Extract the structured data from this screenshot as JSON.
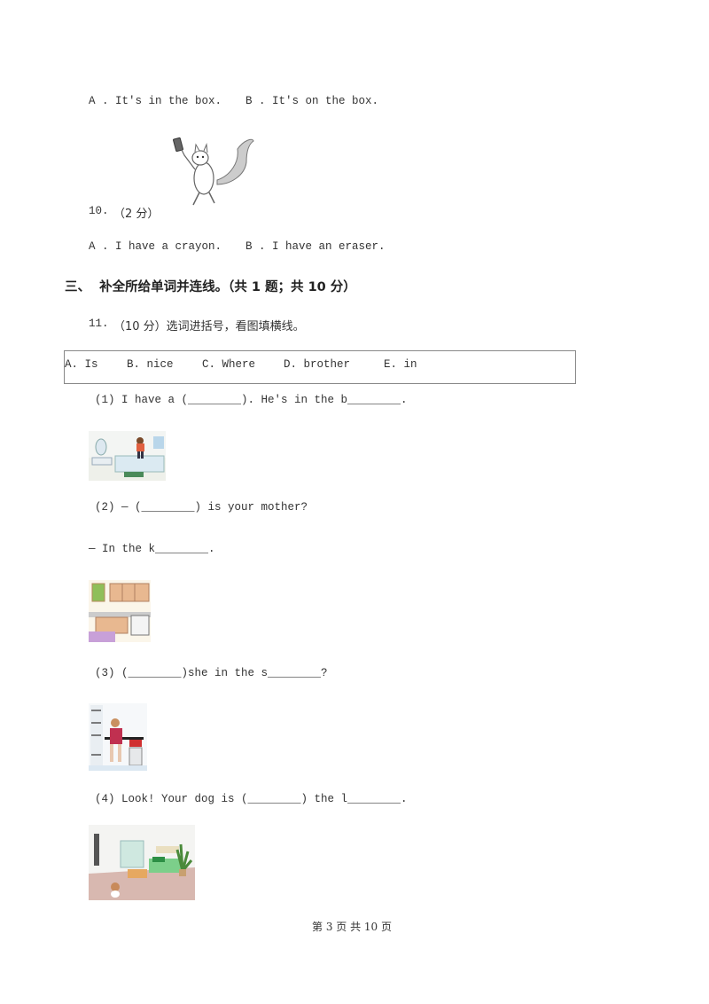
{
  "q9": {
    "option_a": "A . It's in the box.",
    "option_b": "B . It's on the box."
  },
  "q10": {
    "number": "10.",
    "score": "（2 分）",
    "image": "squirrel-holding-eraser",
    "option_a": "A . I have a crayon.",
    "option_b": "B . I have an eraser."
  },
  "section3": {
    "title": "三、  补全所给单词并连线。（共 1 题；共 10 分）"
  },
  "q11": {
    "number": "11.",
    "prompt": "（10 分）选词进括号，看图填横线。",
    "word_bank": [
      "A. Is",
      "B. nice",
      "C. Where",
      "D. brother",
      "E. in"
    ],
    "items": [
      {
        "line1": "(1) I have a (________). He's in the b________.",
        "image": "bathroom-scene"
      },
      {
        "line1": "(2) — (________) is your mother?",
        "line2": "— In the k________.",
        "image": "kitchen-scene"
      },
      {
        "line1": "(3) (________)she in the s________?",
        "image": "study-room-scene"
      },
      {
        "line1": "(4) Look! Your dog is (________) the l________.",
        "image": "living-room-scene"
      }
    ]
  },
  "footer": {
    "page_text": "第 3 页 共 10 页"
  }
}
